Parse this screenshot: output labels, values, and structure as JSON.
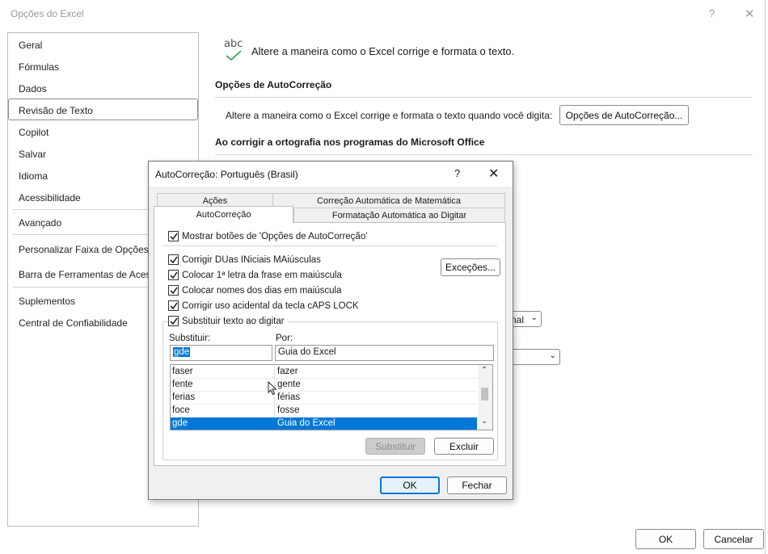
{
  "main_window": {
    "title": "Opções do Excel",
    "help_glyph": "?",
    "close_glyph": "✕",
    "sidebar": {
      "items": [
        {
          "label": "Geral"
        },
        {
          "label": "Fórmulas"
        },
        {
          "label": "Dados"
        },
        {
          "label": "Revisão de Texto",
          "selected": true
        },
        {
          "label": "Copilot"
        },
        {
          "label": "Salvar"
        },
        {
          "label": "Idioma"
        },
        {
          "label": "Acessibilidade"
        },
        {
          "label": "Avançado"
        },
        {
          "label": "Personalizar Faixa de Opções"
        },
        {
          "label": "Barra de Ferramentas de Acesso Rápido"
        },
        {
          "label": "Suplementos"
        },
        {
          "label": "Central de Confiabilidade"
        }
      ]
    },
    "header": {
      "icon": "abc-check-icon",
      "icon_text": "abc",
      "description": "Altere a maneira como o Excel corrige e formata o texto."
    },
    "autocorrect_section": {
      "title": "Opções de AutoCorreção",
      "description": "Altere a maneira como o Excel corrige e formata o texto quando você digita:",
      "button_label": "Opções de AutoCorreção..."
    },
    "spelling_section": {
      "title": "Ao corrigir a ortografia nos programas do Microsoft Office"
    },
    "partial_combo_text": "nal",
    "ok_label": "OK",
    "cancel_label": "Cancelar"
  },
  "dialog": {
    "title": "AutoCorreção: Português (Brasil)",
    "help_glyph": "?",
    "close_glyph": "✕",
    "tabs": [
      {
        "label": "Ações"
      },
      {
        "label": "Correção Automática de Matemática"
      },
      {
        "label": "AutoCorreção",
        "active": true
      },
      {
        "label": "Formatação Automática ao Digitar"
      }
    ],
    "show_buttons_checkbox": {
      "label": "Mostrar botões de 'Opções de AutoCorreção'",
      "checked": true
    },
    "options": [
      {
        "label": "Corrigir DUas INiciais MAiúsculas",
        "checked": true
      },
      {
        "label": "Colocar 1ª letra da frase em maiúscula",
        "checked": true
      },
      {
        "label": "Colocar nomes dos dias em maiúscula",
        "checked": true
      },
      {
        "label": "Corrigir uso acidental da tecla cAPS LOCK",
        "checked": true
      }
    ],
    "exceptions_label": "Exceções...",
    "replace_group": {
      "checkbox_label": "Substituir texto ao digitar",
      "checked": true,
      "replace_label": "Substituir:",
      "with_label": "Por:",
      "replace_value": "gde",
      "with_value": "Guia do Excel",
      "entries": [
        {
          "from": "faser",
          "to": "fazer"
        },
        {
          "from": "fente",
          "to": "gente"
        },
        {
          "from": "ferias",
          "to": "férias"
        },
        {
          "from": "foce",
          "to": "fosse"
        },
        {
          "from": "gde",
          "to": "Guia do Excel",
          "selected": true
        }
      ],
      "replace_button": "Substituir",
      "delete_button": "Excluir"
    },
    "ok_label": "OK",
    "cancel_label": "Fechar"
  }
}
